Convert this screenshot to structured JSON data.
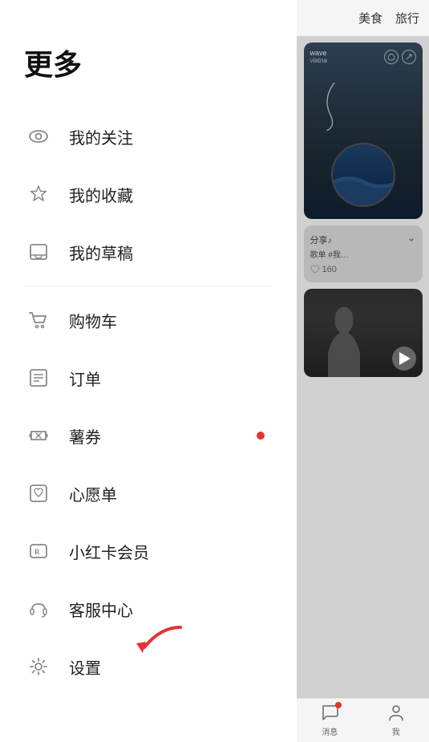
{
  "menu": {
    "title": "更多",
    "items": [
      {
        "id": "my-follow",
        "label": "我的关注",
        "icon": "eye",
        "hasBadge": false
      },
      {
        "id": "my-favorites",
        "label": "我的收藏",
        "icon": "star",
        "hasBadge": false
      },
      {
        "id": "my-drafts",
        "label": "我的草稿",
        "icon": "inbox",
        "hasBadge": false
      },
      {
        "id": "divider1",
        "label": "",
        "icon": "",
        "hasBadge": false,
        "isDivider": true
      },
      {
        "id": "shopping-cart",
        "label": "购物车",
        "icon": "cart",
        "hasBadge": false
      },
      {
        "id": "orders",
        "label": "订单",
        "icon": "order",
        "hasBadge": false
      },
      {
        "id": "coupons",
        "label": "薯券",
        "icon": "coupon",
        "hasBadge": true
      },
      {
        "id": "wishlist",
        "label": "心愿单",
        "icon": "wishlist",
        "hasBadge": false
      },
      {
        "id": "membership",
        "label": "小红卡会员",
        "icon": "membership",
        "hasBadge": false
      },
      {
        "id": "customer-service",
        "label": "客服中心",
        "icon": "headset",
        "hasBadge": false
      },
      {
        "id": "settings",
        "label": "设置",
        "icon": "gear",
        "hasBadge": false
      }
    ]
  },
  "right_panel": {
    "tabs": [
      "美食",
      "旅行"
    ],
    "card1": {
      "username": "wave",
      "subtitle": "vlatna"
    },
    "card2": {
      "text": "分享♪",
      "subtitle": "歌单 #我…",
      "likes": "160"
    },
    "bottom_nav": [
      "消息",
      "我"
    ]
  },
  "arrow": {
    "color": "#e63232"
  }
}
